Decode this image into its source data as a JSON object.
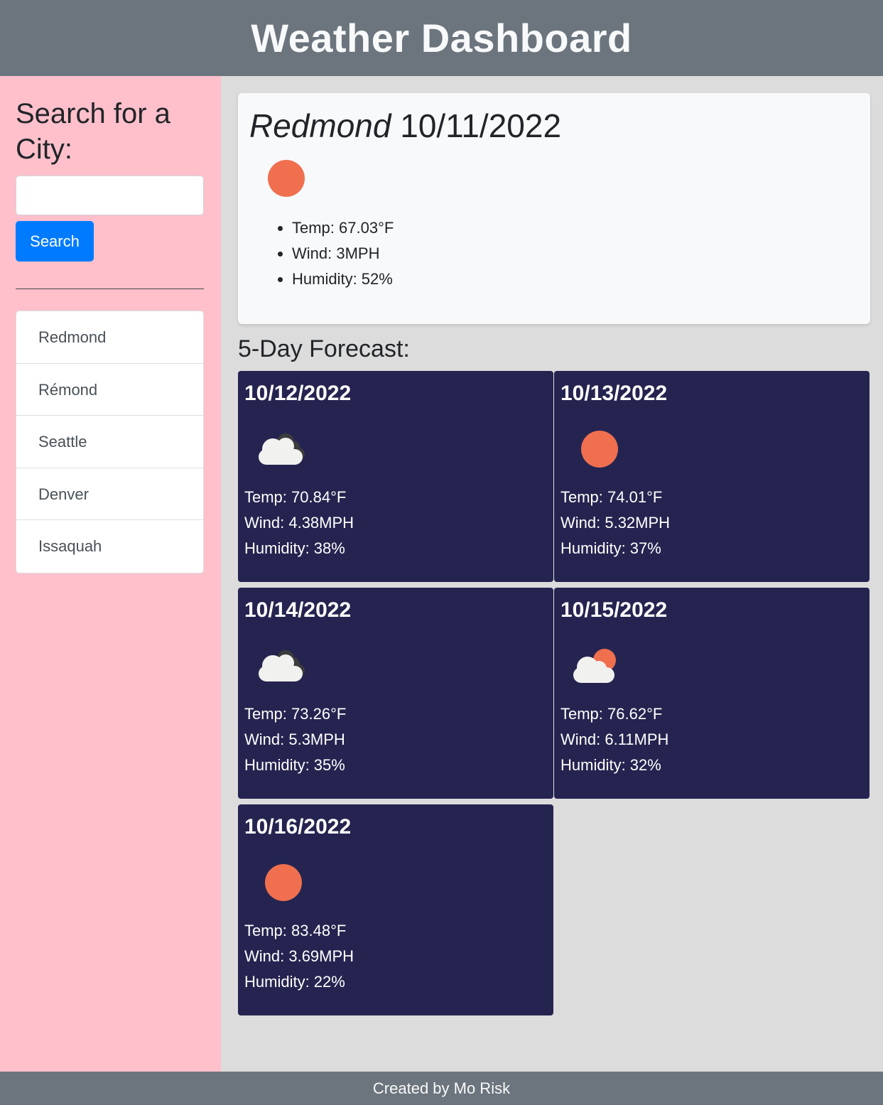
{
  "header": {
    "title": "Weather Dashboard"
  },
  "sidebar": {
    "heading": "Search for a City:",
    "search": {
      "value": "",
      "placeholder": ""
    },
    "search_button_label": "Search",
    "history": [
      "Redmond",
      "Rémond",
      "Seattle",
      "Denver",
      "Issaquah"
    ]
  },
  "current": {
    "city": "Redmond",
    "date": "10/11/2022",
    "icon": "sun-icon",
    "temp": "Temp: 67.03°F",
    "wind": "Wind: 3MPH",
    "humidity": "Humidity: 52%"
  },
  "forecast": {
    "title": "5-Day Forecast:",
    "days": [
      {
        "date": "10/12/2022",
        "icon": "broken-clouds-icon",
        "temp": "Temp: 70.84°F",
        "wind": "Wind: 4.38MPH",
        "humidity": "Humidity: 38%"
      },
      {
        "date": "10/13/2022",
        "icon": "sun-icon",
        "temp": "Temp: 74.01°F",
        "wind": "Wind: 5.32MPH",
        "humidity": "Humidity: 37%"
      },
      {
        "date": "10/14/2022",
        "icon": "broken-clouds-icon",
        "temp": "Temp: 73.26°F",
        "wind": "Wind: 5.3MPH",
        "humidity": "Humidity: 35%"
      },
      {
        "date": "10/15/2022",
        "icon": "partly-cloudy-icon",
        "temp": "Temp: 76.62°F",
        "wind": "Wind: 6.11MPH",
        "humidity": "Humidity: 32%"
      },
      {
        "date": "10/16/2022",
        "icon": "sun-icon",
        "temp": "Temp: 83.48°F",
        "wind": "Wind: 3.69MPH",
        "humidity": "Humidity: 22%"
      }
    ]
  },
  "footer": {
    "text": "Created by Mo Risk"
  },
  "colors": {
    "header_bg": "#6c757d",
    "sidebar_bg": "#ffc0cb",
    "card_bg": "#252450",
    "button_bg": "#007bff",
    "sun": "#ef6f4f"
  }
}
